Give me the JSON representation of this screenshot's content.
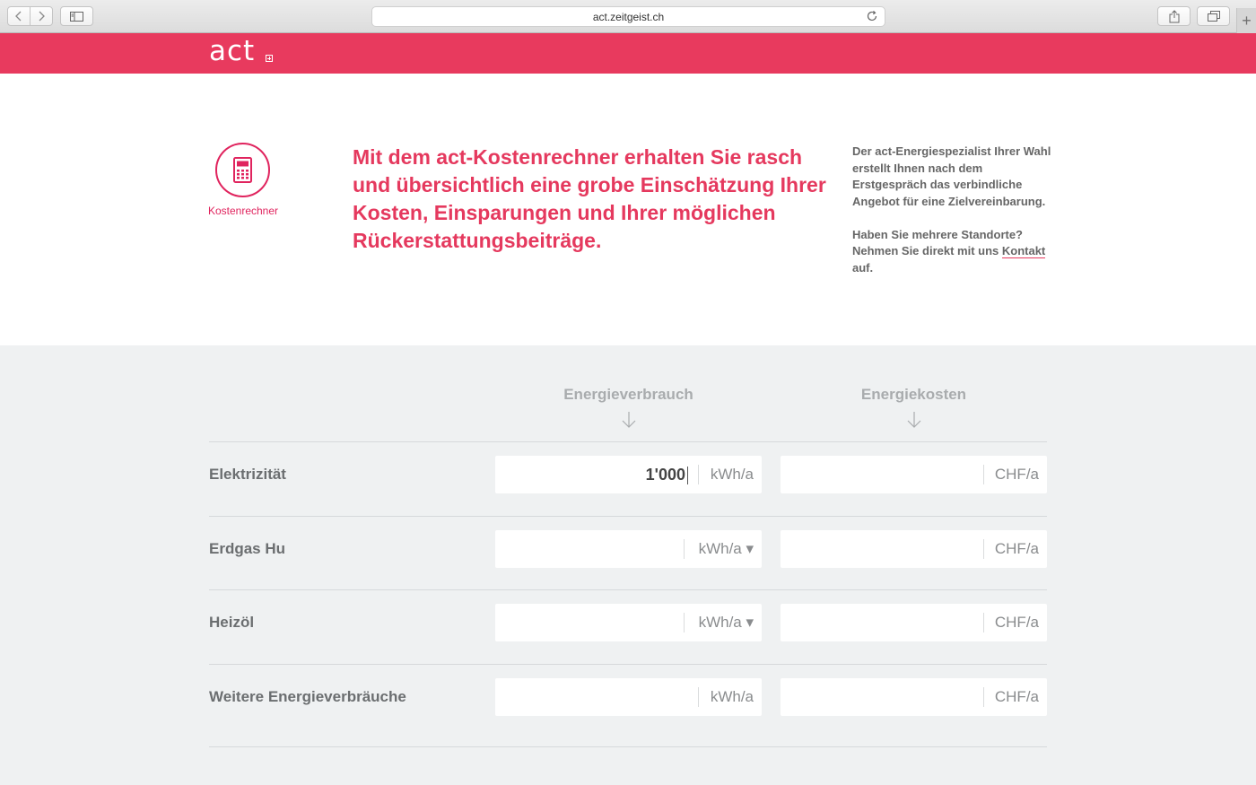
{
  "browser": {
    "url": "act.zeitgeist.ch"
  },
  "brand": {
    "logo_text": "act"
  },
  "intro": {
    "icon_label": "Kostenrechner",
    "headline": "Mit dem act-Kostenrechner erhalten Sie rasch und übersichtlich eine grobe Einschätzung Ihrer Kosten, Einsparungen und Ihrer möglichen Rückerstattungsbeiträge.",
    "side_text_1": "Der act-Energiespezialist Ihrer Wahl erstellt Ihnen nach dem Erstgespräch das verbindliche Angebot für eine Zielvereinbarung.",
    "side_text_2_prefix": "Haben Sie mehrere Standorte? Nehmen Sie direkt mit uns ",
    "side_link": "Kontakt",
    "side_text_2_suffix": " auf."
  },
  "calculator": {
    "col_consumption": "Energieverbrauch",
    "col_costs": "Energiekosten",
    "rows": [
      {
        "label": "Elektrizität",
        "consumption_value": "1'000",
        "consumption_unit": "kWh/a",
        "cost_value": "",
        "cost_unit": "CHF/a"
      },
      {
        "label": "Erdgas Hu",
        "consumption_value": "",
        "consumption_unit": "kWh/a ▾",
        "cost_value": "",
        "cost_unit": "CHF/a"
      },
      {
        "label": "Heizöl",
        "consumption_value": "",
        "consumption_unit": "kWh/a ▾",
        "cost_value": "",
        "cost_unit": "CHF/a"
      },
      {
        "label": "Weitere Energieverbräuche",
        "consumption_value": "",
        "consumption_unit": "kWh/a",
        "cost_value": "",
        "cost_unit": "CHF/a"
      }
    ]
  },
  "colors": {
    "brand": "#e83a5e",
    "background_grey": "#eff1f2"
  },
  "icons": [
    "back-icon",
    "forward-icon",
    "sidebar-icon",
    "reload-icon",
    "share-icon",
    "tabs-icon",
    "plus-icon",
    "calculator-icon",
    "arrow-down-icon"
  ]
}
